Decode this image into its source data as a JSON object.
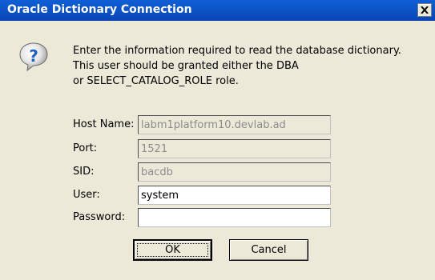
{
  "window": {
    "title": "Oracle Dictionary Connection"
  },
  "message": {
    "lines": [
      "Enter the information required to read the database dictionary.",
      "This user should be granted either the DBA",
      "or SELECT_CATALOG_ROLE role."
    ]
  },
  "form": {
    "host_name": {
      "label": "Host Name:",
      "value": "labm1platform10.devlab.ad"
    },
    "port": {
      "label": "Port:",
      "value": "1521"
    },
    "sid": {
      "label": "SID:",
      "value": "bacdb"
    },
    "user": {
      "label": "User:",
      "value": "system"
    },
    "password": {
      "label": "Password:",
      "value": ""
    }
  },
  "buttons": {
    "ok": "OK",
    "cancel": "Cancel"
  },
  "icons": {
    "close": "close-icon",
    "question": "question-icon"
  },
  "colors": {
    "titlebar": "#0946b4",
    "dialog_bg": "#ece9d8",
    "question_blue": "#1d5fc6"
  }
}
